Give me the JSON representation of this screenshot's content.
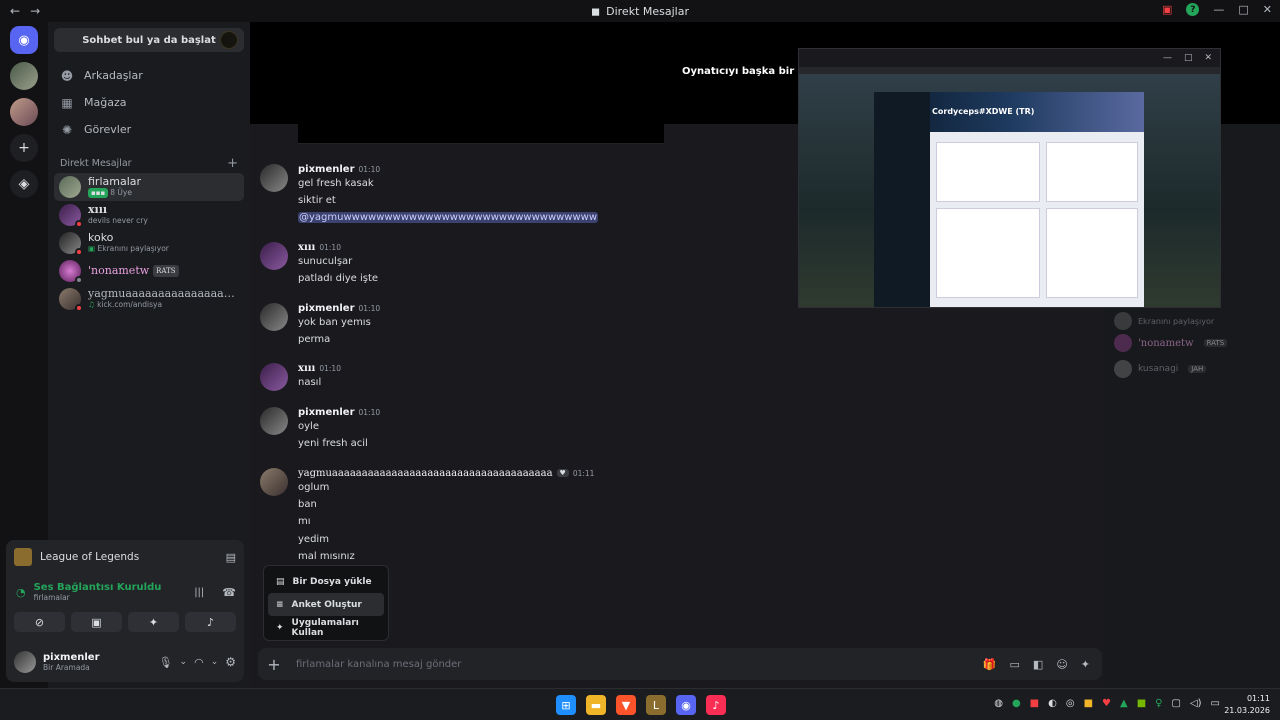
{
  "window": {
    "title": "Direkt Mesajlar",
    "back_icon": "←",
    "forward_icon": "→"
  },
  "sidebar": {
    "search_label": "Sohbet bul ya da başlat",
    "nav": [
      {
        "label": "Arkadaşlar",
        "icon": "friends-icon"
      },
      {
        "label": "Mağaza",
        "icon": "shop-icon"
      },
      {
        "label": "Görevler",
        "icon": "quests-icon"
      }
    ],
    "dm_header": "Direkt Mesajlar",
    "dm_add": "+",
    "dms": [
      {
        "name": "firlamalar",
        "sub": "8 Üye"
      },
      {
        "name": "xııı",
        "sub": "devils never cry"
      },
      {
        "name": "koko",
        "sub": "Ekranını paylaşıyor"
      },
      {
        "name": "'nonametw",
        "tag": "RATS"
      },
      {
        "name": "yagmuaaaaaaaaaaaaaaaaa...",
        "sub": "kick.com/andisya"
      }
    ]
  },
  "activity": {
    "game": "League of Legends",
    "voice_status": "Ses Bağlantısı Kuruldu",
    "voice_channel": "firlamalar",
    "user_name": "pixmenler",
    "user_status": "Bir Aramada"
  },
  "stream": {
    "banner": "Oynatıcıyı başka bir pence",
    "profile_name": "Cordyceps#XDWE (TR)"
  },
  "messages": [
    {
      "author": "pixmenler",
      "time": "01:10",
      "lines": [
        "gel fresh kasak",
        "siktir et"
      ],
      "mention": "@yagmuwwwwwwwwwwwwwwwwwwwwwwwwwwwwwww"
    },
    {
      "author": "xııı",
      "time": "01:10",
      "lines": [
        "sunuculşar",
        "patladı diye işte"
      ]
    },
    {
      "author": "pixmenler",
      "time": "01:10",
      "lines": [
        "yok ban yemıs",
        "perma"
      ]
    },
    {
      "author": "xııı",
      "time": "01:10",
      "lines": [
        "nasıl"
      ]
    },
    {
      "author": "pixmenler",
      "time": "01:10",
      "lines": [
        "oyle",
        "yeni fresh acil"
      ]
    },
    {
      "author": "yagmuaaaaaaaaaaaaaaaaaaaaaaaaaaaaaaaaaaaaa",
      "time": "01:11",
      "lines": [
        "oglum",
        "ban",
        "mı",
        "yedim",
        "mal mısınız"
      ]
    }
  ],
  "popup": {
    "items": [
      "Bir Dosya yükle",
      "Anket Oluştur",
      "Uygulamaları Kullan"
    ]
  },
  "composer": {
    "placeholder": "firlamalar kanalına mesaj gönder"
  },
  "members": [
    {
      "name": "Ekranını paylaşıyor"
    },
    {
      "name": "'nonametw",
      "tag": "RATS"
    },
    {
      "name": "kusanagi",
      "tag": "JAH"
    }
  ],
  "taskbar": {
    "time": "01:11",
    "date": "21.03.2026"
  }
}
